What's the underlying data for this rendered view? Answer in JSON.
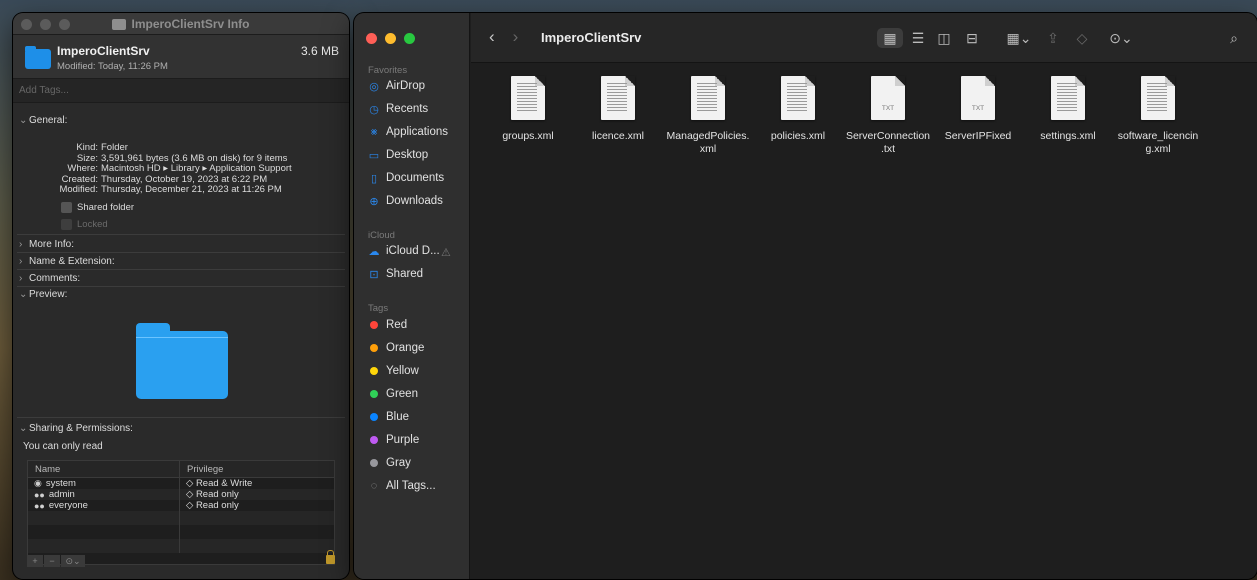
{
  "info": {
    "title": "ImperoClientSrv Info",
    "name": "ImperoClientSrv",
    "size": "3.6 MB",
    "modified": "Modified: Today, 11:26 PM",
    "tags_placeholder": "Add Tags...",
    "general_label": "General:",
    "general": [
      {
        "k": "Kind:",
        "v": "Folder"
      },
      {
        "k": "Size:",
        "v": "3,591,961 bytes (3.6 MB on disk) for 9 items"
      },
      {
        "k": "Where:",
        "v": "Macintosh HD ▸ Library ▸ Application Support"
      },
      {
        "k": "Created:",
        "v": "Thursday, October 19, 2023 at 6:22 PM"
      },
      {
        "k": "Modified:",
        "v": "Thursday, December 21, 2023 at 11:26 PM"
      }
    ],
    "shared_folder": "Shared folder",
    "locked": "Locked",
    "more_info": "More Info:",
    "name_ext": "Name & Extension:",
    "comments": "Comments:",
    "preview": "Preview:",
    "sharing": "Sharing & Permissions:",
    "only_read": "You can only read",
    "col_name": "Name",
    "col_priv": "Privilege",
    "perms": [
      {
        "name": "system",
        "priv": "◇ Read & Write"
      },
      {
        "name": "admin",
        "priv": "◇ Read only"
      },
      {
        "name": "everyone",
        "priv": "◇ Read only"
      }
    ]
  },
  "finder": {
    "path": "ImperoClientSrv",
    "favorites_label": "Favorites",
    "favorites": [
      "AirDrop",
      "Recents",
      "Applications",
      "Desktop",
      "Documents",
      "Downloads"
    ],
    "icloud_label": "iCloud",
    "icloud": [
      "iCloud D...",
      "Shared"
    ],
    "tags_label": "Tags",
    "tags": [
      {
        "name": "Red",
        "color": "#ff453a"
      },
      {
        "name": "Orange",
        "color": "#ff9f0a"
      },
      {
        "name": "Yellow",
        "color": "#ffd60a"
      },
      {
        "name": "Green",
        "color": "#30d158"
      },
      {
        "name": "Blue",
        "color": "#0a84ff"
      },
      {
        "name": "Purple",
        "color": "#bf5af2"
      },
      {
        "name": "Gray",
        "color": "#98989d"
      }
    ],
    "all_tags": "All Tags...",
    "files": [
      {
        "name": "groups.xml",
        "type": "xml"
      },
      {
        "name": "licence.xml",
        "type": "xml"
      },
      {
        "name": "ManagedPolicies.\nxml",
        "type": "xml"
      },
      {
        "name": "policies.xml",
        "type": "xml"
      },
      {
        "name": "ServerConnection\n.txt",
        "type": "txt"
      },
      {
        "name": "ServerIPFixed",
        "type": "txt"
      },
      {
        "name": "settings.xml",
        "type": "xml"
      },
      {
        "name": "software_licencin\ng.xml",
        "type": "xml"
      }
    ],
    "txt_label": "TXT"
  },
  "colors": {
    "accent": "#2a88ee",
    "folder": "#2aa0f0"
  }
}
